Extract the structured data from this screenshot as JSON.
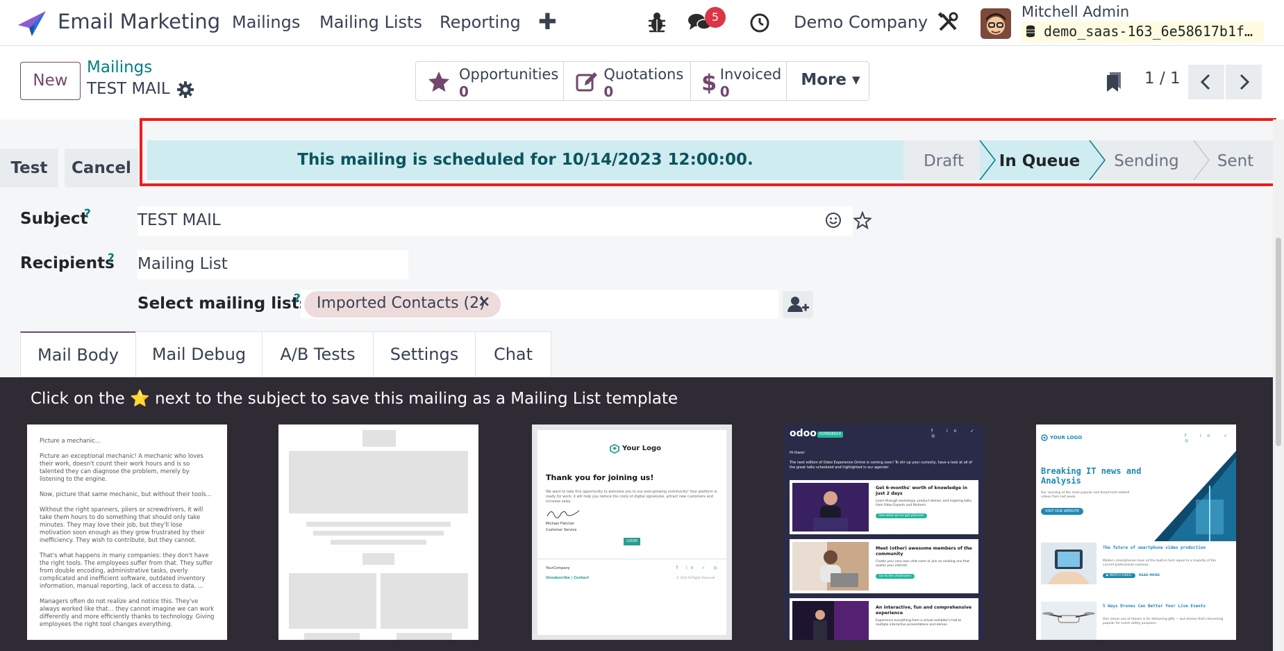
{
  "nav": {
    "app_name": "Email Marketing",
    "menus": [
      "Mailings",
      "Mailing Lists",
      "Reporting"
    ],
    "plus": "✚",
    "chat_badge": "5",
    "company": "Demo Company",
    "user_name": "Mitchell Admin",
    "db_name": "demo_saas-163_6e58617b1f…"
  },
  "control": {
    "new_label": "New",
    "breadcrumb": "Mailings",
    "record_title": "TEST MAIL",
    "smart_buttons": [
      {
        "label": "Opportunities",
        "value": "0",
        "icon": "star-icon"
      },
      {
        "label": "Quotations",
        "value": "0",
        "icon": "edit-icon"
      },
      {
        "label": "Invoiced",
        "value": "0",
        "icon": "dollar-icon"
      }
    ],
    "more_label": "More ▾",
    "pager": "1 / 1"
  },
  "statusbar": {
    "test_label": "Test",
    "cancel_label": "Cancel",
    "alert": "This mailing is scheduled for 10/14/2023 12:00:00.",
    "stages": [
      "Draft",
      "In Queue",
      "Sending",
      "Sent"
    ],
    "current_stage": "In Queue"
  },
  "form": {
    "subject_label": "Subject",
    "subject_value": "TEST MAIL",
    "recipients_label": "Recipients",
    "recipients_value": "Mailing List",
    "lists_label": "Select mailing lists:",
    "help_mark": "?",
    "tag": "Imported Contacts (2)",
    "tag_remove": "×"
  },
  "tabs": [
    "Mail Body",
    "Mail Debug",
    "A/B Tests",
    "Settings",
    "Chat"
  ],
  "templates": {
    "hint": "Click on the ⭐ next to the subject to save this mailing as a Mailing List template",
    "t1": {
      "lines": [
        "Picture a mechanic...",
        "Picture an exceptional mechanic! A mechanic who loves their work, doesn't count their work hours and is so talented they can diagnose the problem, merely by listening to the engine.",
        "Now, picture that same mechanic, but without their tools...",
        "Without the right spanners, pliers or screwdrivers, it will take them hours to do something that should only take minutes. They may love their job, but they'll lose motivation soon enough as they grow frustrated by their inefficiency. They wish to contribute, but they cannot.",
        "That's what happens in many companies: they don't have the right tools. The employees suffer from that. They suffer from double encoding, administrative tasks, overly complicated and inefficient software, outdated inventory information, manual reporting, lack of access to data, ...",
        "Managers often do not realize and notice this. They've always worked like that... they cannot imagine we can work differently and more efficiently thanks to technology. Giving employees the right tool changes everything."
      ]
    },
    "t3": {
      "logo": "Your Logo",
      "heading": "Thank you for joining us!",
      "body": "We want to take this opportunity to welcome you to our ever-growing community! Your platform is ready for work, it will help you reduce the costs of digital signatures, attract new customers and increase sales.",
      "signer": "Michael Fletcher",
      "signer_role": "Customer Service",
      "button": "LOGIN",
      "footer_company": "YourCompany",
      "footer_links": "Unsubscribe | Contact",
      "copyright": "© 2024 All Rights Reserved"
    },
    "t4": {
      "brand": "odoo",
      "brand_tag": "EXPERIENCE",
      "greeting": "Hi there!",
      "intro": "The next edition of Odoo Experience Online is coming soon! To stir up your curiosity, have a look at all of the great talks scheduled and highlighted in our agenda!",
      "cards": [
        {
          "title": "Get 6-months' worth of knowledge in just 2 days",
          "text": "Learn through workshops, product demos, and inspiring talks from Odoo Experts and Partners.",
          "btn": "See what we've got planned"
        },
        {
          "title": "Meet (other) awesome members of the community",
          "text": "Create your very own chat room or join an existing one that sparks your interest.",
          "btn": "Go to the chatrooms"
        },
        {
          "title": "An interactive, fun and comprehensive experience",
          "text": "Experience everything from a virtual exhibitor's hall to multiple interactive presentations and demos.",
          "btn": ""
        }
      ]
    },
    "t5": {
      "logo": "YOUR LOGO",
      "headline": "Breaking IT news and Analysis",
      "sub": "Our roundup of the most popular and broad tech-related videos from last week.",
      "btn": "VISIT OUR WEBSITE",
      "story1_title": "The future of smartphone video production",
      "story1_text": "Modern smartphones have all the built-in tech equal to a majority of the current professional cameras.",
      "story1_btn": "WATCH VIDEO",
      "story1_more": "READ MORE",
      "story2_title": "5 Ways Drones Can Better Your Live Events",
      "story2_text": "One clever use of drones is for delivering gifts — but drones that's becoming popular for event safety purposes."
    }
  },
  "colors": {
    "brand": "#71476e",
    "teal": "#017e84",
    "alert_bg": "#cfecf0",
    "highlight": "#ee1c1c",
    "dark_panel": "#2e2b35"
  }
}
